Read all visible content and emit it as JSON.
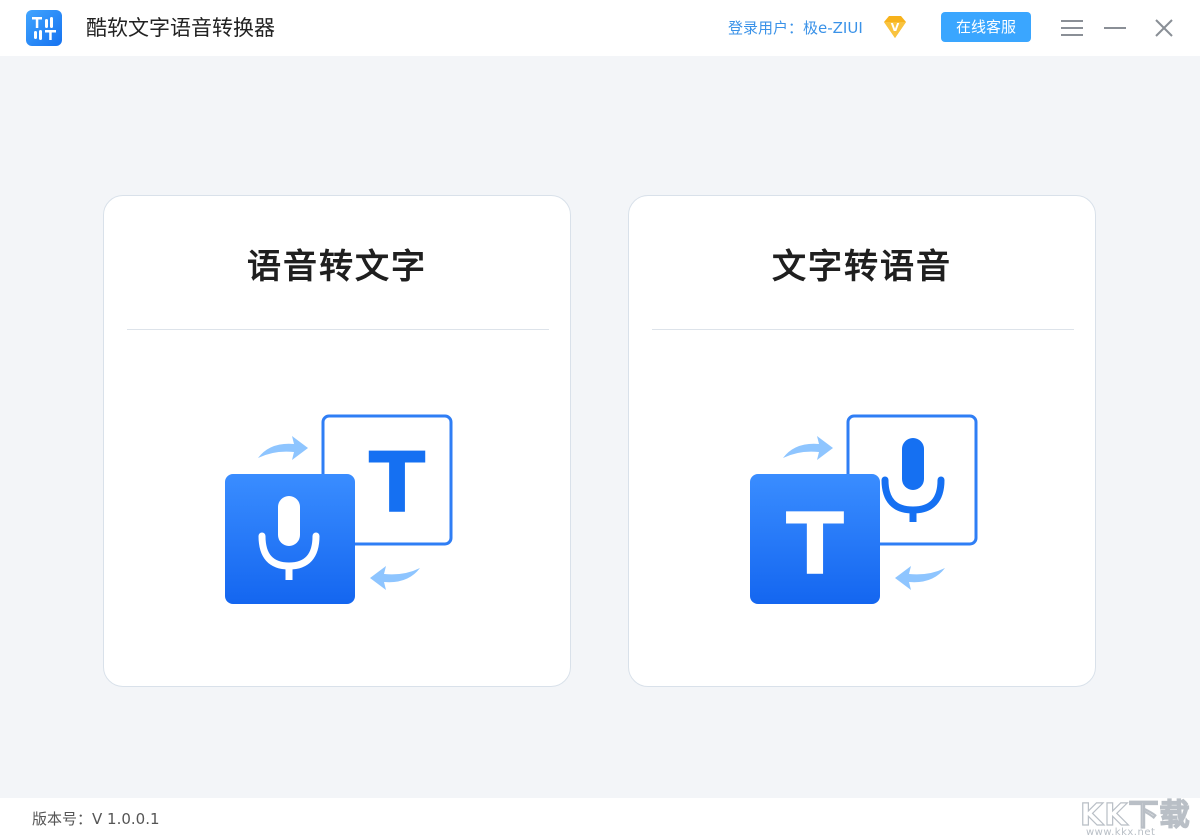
{
  "app": {
    "title": "酷软文字语音转换器",
    "logo_icon": "app-logo-icon"
  },
  "header": {
    "user_label": "登录用户：极e-ZIUI",
    "vip_icon": "vip-diamond-icon",
    "vip_badge": "V",
    "service_button": "在线客服",
    "menu_icon": "hamburger-menu-icon",
    "minimize_icon": "minimize-icon",
    "close_icon": "close-icon"
  },
  "cards": [
    {
      "title": "语音转文字",
      "icon": "speech-to-text-icon",
      "glyph": "T"
    },
    {
      "title": "文字转语音",
      "icon": "text-to-speech-icon",
      "glyph": "T"
    }
  ],
  "footer": {
    "version": "版本号：V 1.0.0.1",
    "watermark": "KK下载",
    "watermark_url": "www.kkx.net"
  },
  "colors": {
    "accent": "#1677ff",
    "accent_light": "#3aa6ff",
    "arrow": "#8ec5ff",
    "background": "#f3f5f8"
  }
}
